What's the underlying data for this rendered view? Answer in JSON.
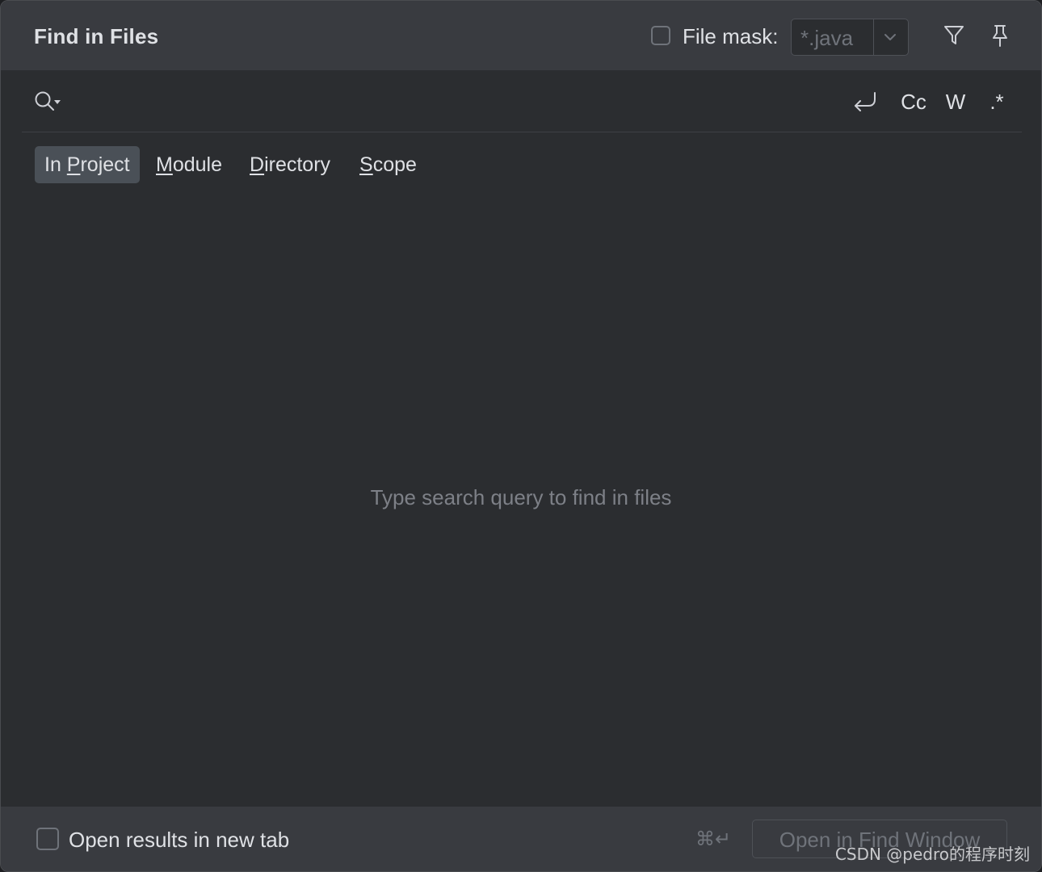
{
  "window": {
    "title": "Find in Files"
  },
  "header": {
    "file_mask_label": "File mask:",
    "file_mask_value": "*.java",
    "file_mask_checked": false,
    "icons": [
      "filter-icon",
      "pin-icon",
      "chevron-down-icon"
    ]
  },
  "search": {
    "value": "",
    "icon": "search-history-icon",
    "options": {
      "newline": "⮐",
      "match_case": "Cc",
      "words": "W",
      "regex": ".*"
    }
  },
  "scopes": {
    "tabs": [
      {
        "before": "In ",
        "mnemonic": "P",
        "after": "roject",
        "selected": true
      },
      {
        "before": "",
        "mnemonic": "M",
        "after": "odule",
        "selected": false
      },
      {
        "before": "",
        "mnemonic": "D",
        "after": "irectory",
        "selected": false
      },
      {
        "before": "",
        "mnemonic": "S",
        "after": "cope",
        "selected": false
      }
    ]
  },
  "results": {
    "empty_message": "Type search query to find in files"
  },
  "footer": {
    "new_tab_label": "Open results in new tab",
    "new_tab_checked": false,
    "shortcut": "⌘↵",
    "open_button_label": "Open in Find Window"
  },
  "watermark": "CSDN @pedro的程序时刻",
  "colors": {
    "background": "#2b2d30",
    "header": "#393b40",
    "text": "#dfe1e5",
    "muted": "#6f737a",
    "selected_tab": "#4a5057"
  }
}
